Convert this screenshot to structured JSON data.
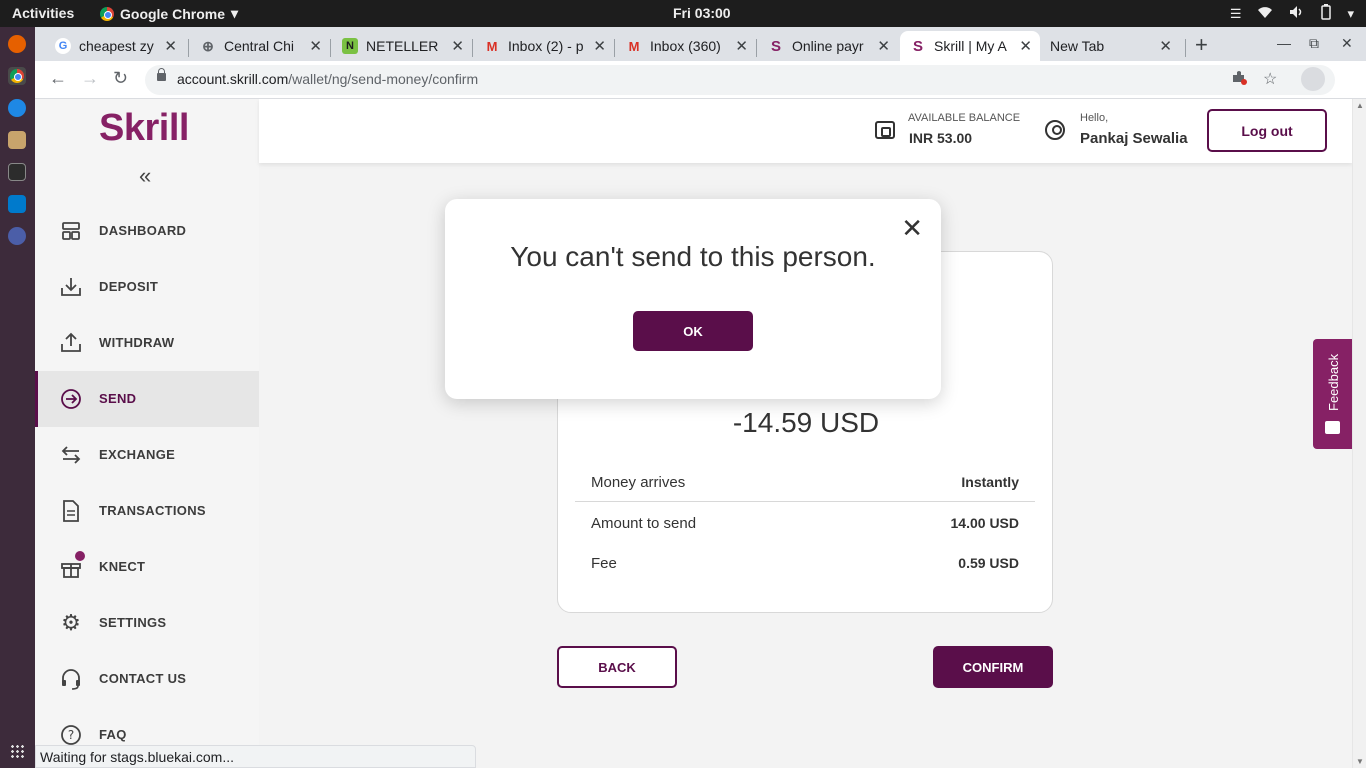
{
  "system": {
    "activities": "Activities",
    "app_name": "Google Chrome",
    "clock": "Fri 03:00"
  },
  "browser": {
    "tabs": [
      {
        "title": "cheapest zy",
        "favicon": "google-icon"
      },
      {
        "title": "Central Chi",
        "favicon": "globe-icon"
      },
      {
        "title": "NETELLER",
        "favicon": "neteller-icon"
      },
      {
        "title": "Inbox (2) - p",
        "favicon": "gmail-icon"
      },
      {
        "title": "Inbox (360)",
        "favicon": "gmail-icon"
      },
      {
        "title": "Online payr",
        "favicon": "skrill-icon"
      },
      {
        "title": "Skrill | My A",
        "favicon": "skrill-icon"
      },
      {
        "title": "New Tab",
        "favicon": ""
      }
    ],
    "url_host": "account.skrill.com",
    "url_path": "/wallet/ng/send-money/confirm",
    "status_text": "Waiting for stags.bluekai.com..."
  },
  "brand": {
    "logo_text": "Skrill",
    "primary_color": "#5a0e4a",
    "accent_color": "#862165"
  },
  "sidebar": {
    "items": [
      {
        "label": "DASHBOARD",
        "icon": "dashboard-icon"
      },
      {
        "label": "DEPOSIT",
        "icon": "deposit-icon"
      },
      {
        "label": "WITHDRAW",
        "icon": "withdraw-icon"
      },
      {
        "label": "SEND",
        "icon": "send-icon"
      },
      {
        "label": "EXCHANGE",
        "icon": "exchange-icon"
      },
      {
        "label": "TRANSACTIONS",
        "icon": "transactions-icon"
      },
      {
        "label": "KNECT",
        "icon": "gift-icon"
      },
      {
        "label": "SETTINGS",
        "icon": "gear-icon"
      },
      {
        "label": "CONTACT US",
        "icon": "headset-icon"
      },
      {
        "label": "FAQ",
        "icon": "question-icon"
      }
    ]
  },
  "header": {
    "balance_label": "AVAILABLE BALANCE",
    "balance_value": "INR 53.00",
    "hello_label": "Hello,",
    "user_name": "Pankaj Sewalia",
    "logout_label": "Log out"
  },
  "summary": {
    "total": "-14.59 USD",
    "rows": [
      {
        "label": "Money arrives",
        "value": "Instantly"
      },
      {
        "label": "Amount to send",
        "value": "14.00 USD"
      },
      {
        "label": "Fee",
        "value": "0.59 USD"
      }
    ],
    "back_label": "BACK",
    "confirm_label": "CONFIRM"
  },
  "feedback": {
    "label": "Feedback"
  },
  "modal": {
    "message": "You can't send to this person.",
    "ok_label": "OK"
  }
}
